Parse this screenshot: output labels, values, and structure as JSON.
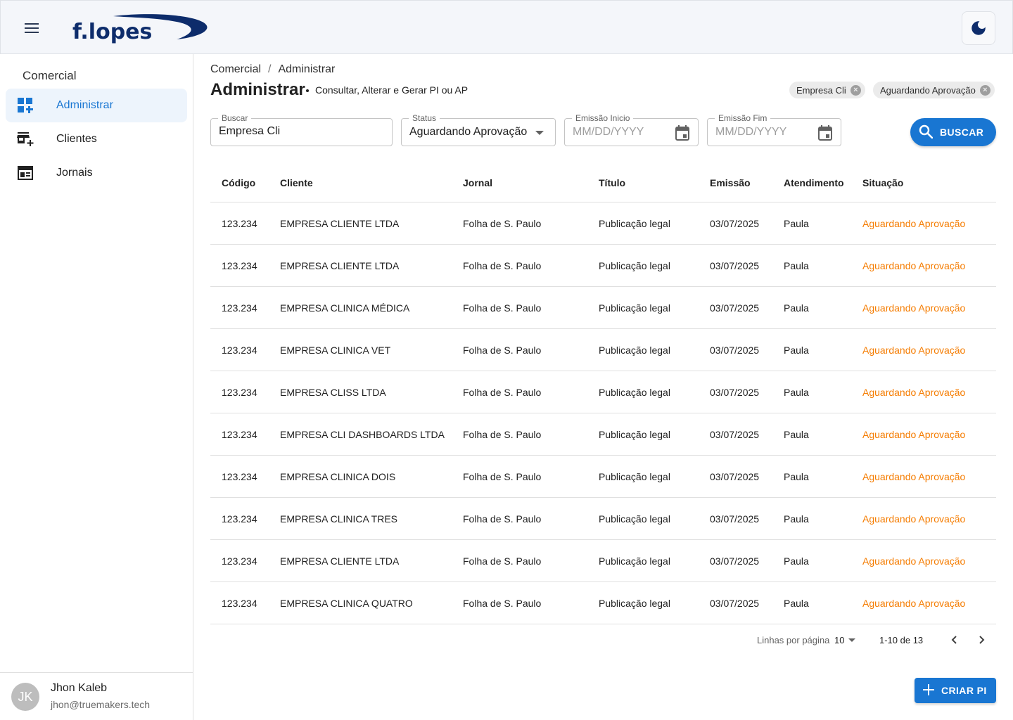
{
  "header": {
    "logo_text": "f.lopes",
    "menu_icon": "menu-icon",
    "theme_icon": "moon-icon"
  },
  "sidebar": {
    "section_title": "Comercial",
    "items": [
      {
        "label": "Administrar",
        "icon": "dashboard-add-icon",
        "active": true
      },
      {
        "label": "Clientes",
        "icon": "store-add-icon",
        "active": false
      },
      {
        "label": "Jornais",
        "icon": "newspaper-icon",
        "active": false
      }
    ],
    "user": {
      "initials": "JK",
      "name": "Jhon Kaleb",
      "email": "jhon@truemakers.tech"
    }
  },
  "main": {
    "breadcrumb": [
      "Comercial",
      "Administrar"
    ],
    "title": "Administrar",
    "subtitle": "Consultar, Alterar e Gerar PI ou AP",
    "chips": [
      "Empresa Cli",
      "Aguardando Aprovação"
    ],
    "filters": {
      "buscar": {
        "label": "Buscar",
        "value": "Empresa Cli"
      },
      "status": {
        "label": "Status",
        "value": "Aguardando Aprovação"
      },
      "emissao_inicio": {
        "label": "Emissão Inicio",
        "placeholder": "MM/DD/YYYY"
      },
      "emissao_fim": {
        "label": "Emissão Fim",
        "placeholder": "MM/DD/YYYY"
      }
    },
    "search_button": "BUSCAR",
    "table": {
      "columns": [
        "Código",
        "Cliente",
        "Jornal",
        "Título",
        "Emissão",
        "Atendimento",
        "Situação"
      ],
      "rows": [
        [
          "123.234",
          "EMPRESA CLIENTE LTDA",
          "Folha de S. Paulo",
          "Publicação legal",
          "03/07/2025",
          "Paula",
          "Aguardando Aprovação"
        ],
        [
          "123.234",
          "EMPRESA CLIENTE LTDA",
          "Folha de S. Paulo",
          "Publicação legal",
          "03/07/2025",
          "Paula",
          "Aguardando Aprovação"
        ],
        [
          "123.234",
          "EMPRESA CLINICA MÉDICA",
          "Folha de S. Paulo",
          "Publicação legal",
          "03/07/2025",
          "Paula",
          "Aguardando Aprovação"
        ],
        [
          "123.234",
          "EMPRESA CLINICA VET",
          "Folha de S. Paulo",
          "Publicação legal",
          "03/07/2025",
          "Paula",
          "Aguardando Aprovação"
        ],
        [
          "123.234",
          "EMPRESA CLISS LTDA",
          "Folha de S. Paulo",
          "Publicação legal",
          "03/07/2025",
          "Paula",
          "Aguardando Aprovação"
        ],
        [
          "123.234",
          "EMPRESA CLI DASHBOARDS LTDA",
          "Folha de S. Paulo",
          "Publicação legal",
          "03/07/2025",
          "Paula",
          "Aguardando Aprovação"
        ],
        [
          "123.234",
          "EMPRESA CLINICA DOIS",
          "Folha de S. Paulo",
          "Publicação legal",
          "03/07/2025",
          "Paula",
          "Aguardando Aprovação"
        ],
        [
          "123.234",
          "EMPRESA CLINICA TRES",
          "Folha de S. Paulo",
          "Publicação legal",
          "03/07/2025",
          "Paula",
          "Aguardando Aprovação"
        ],
        [
          "123.234",
          "EMPRESA CLIENTE LTDA",
          "Folha de S. Paulo",
          "Publicação legal",
          "03/07/2025",
          "Paula",
          "Aguardando Aprovação"
        ],
        [
          "123.234",
          "EMPRESA CLINICA QUATRO",
          "Folha de S. Paulo",
          "Publicação legal",
          "03/07/2025",
          "Paula",
          "Aguardando Aprovação"
        ]
      ]
    },
    "pagination": {
      "rows_per_page_label": "Linhas por página",
      "rows_per_page": "10",
      "range": "1-10 de 13"
    },
    "create_button": "CRIAR PI"
  },
  "colors": {
    "primary": "#1976d2",
    "status_pending": "#f57c00",
    "logo": "#0d2c6b",
    "active_nav_bg": "#edf4fc"
  }
}
